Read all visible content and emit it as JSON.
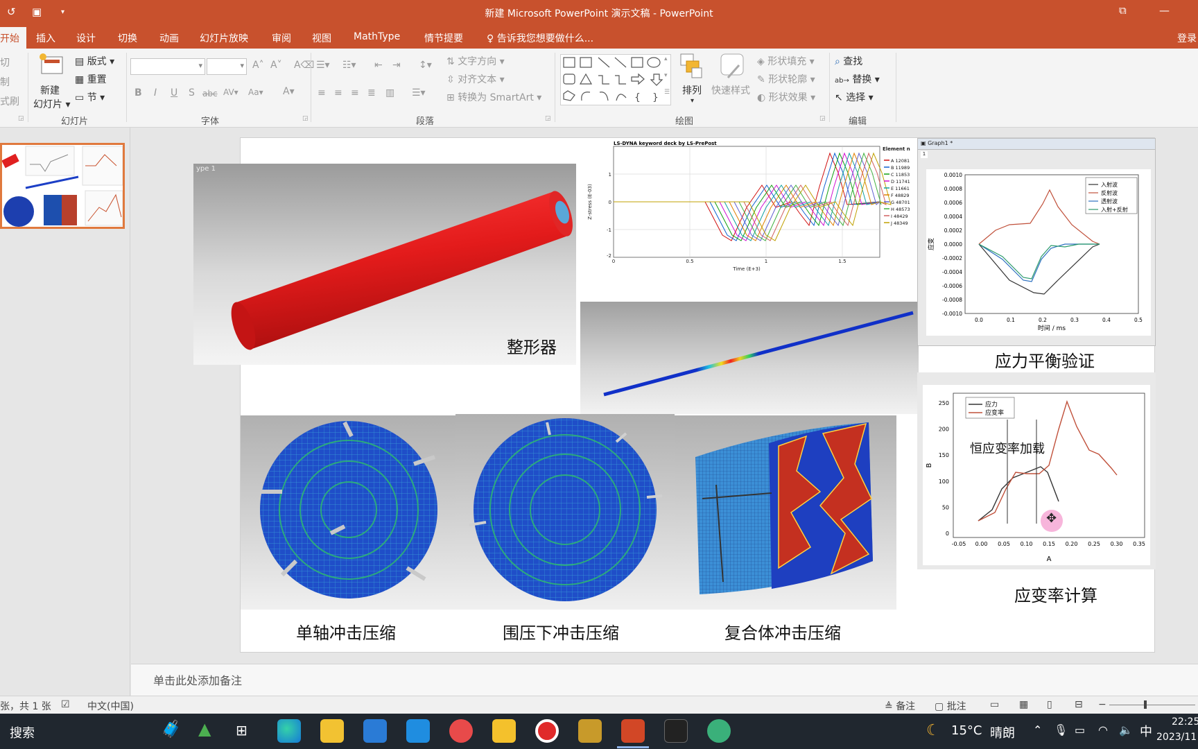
{
  "window": {
    "title": "新建 Microsoft PowerPoint 演示文稿 - PowerPoint"
  },
  "tabs": [
    {
      "label": "开始",
      "active": true
    },
    {
      "label": "插入"
    },
    {
      "label": "设计"
    },
    {
      "label": "切换"
    },
    {
      "label": "动画"
    },
    {
      "label": "幻灯片放映"
    },
    {
      "label": "审阅"
    },
    {
      "label": "视图"
    },
    {
      "label": "MathType"
    },
    {
      "label": "情节提要"
    }
  ],
  "tellme": "告诉我您想要做什么...",
  "login": "登录",
  "ribbon": {
    "clipboard": {
      "cut": "切",
      "copy": "制",
      "painter": "式刷"
    },
    "slides": {
      "new_slide_1": "新建",
      "new_slide_2": "幻灯片",
      "layout": "版式",
      "reset": "重置",
      "section": "节",
      "group": "幻灯片"
    },
    "font": {
      "group": "字体"
    },
    "paragraph": {
      "text_direction": "文字方向",
      "align_text": "对齐文本",
      "smartart": "转换为 SmartArt",
      "group": "段落"
    },
    "drawing": {
      "arrange": "排列",
      "quick_styles": "快速样式",
      "fill": "形状填充",
      "outline": "形状轮廓",
      "effects": "形状效果",
      "group": "绘图"
    },
    "editing": {
      "find": "查找",
      "replace": "替换",
      "select": "选择",
      "group": "编辑"
    }
  },
  "slide": {
    "captions": {
      "shaper": "整形器",
      "stress_balance": "应力平衡验证",
      "strain_rate": "应变率计算",
      "uniaxial": "单轴冲击压缩",
      "confined": "围压下冲击压缩",
      "composite": "复合体冲击压缩"
    },
    "constant_rate_label": "恒应变率加载",
    "lsdyna": {
      "header": "LS-DYNA keyword deck by LS-PrePost",
      "xlabel": "Time (E+3)",
      "ylabel": "Z-stress (E-03)",
      "legend_title": "Element no.",
      "legend": [
        "A 12081",
        "B 11989",
        "C 11853",
        "D 11741",
        "E 11661",
        "F 48829",
        "G 48701",
        "H 48573",
        "I 48429",
        "J 48349"
      ],
      "xticks": [
        "0",
        "0.5",
        "1",
        "1.5"
      ],
      "yticks": [
        "1",
        "0",
        "-1",
        "-2"
      ]
    },
    "graph1": {
      "window_title": "Graph1 *",
      "page_num": "1",
      "legend": [
        "入射波",
        "反射波",
        "透射波",
        "入射+反射"
      ],
      "xlabel": "时间 / ms",
      "ylabel": "应变",
      "xticks": [
        "0.0",
        "0.1",
        "0.2",
        "0.3",
        "0.4",
        "0.5"
      ],
      "yticks": [
        "0.0010",
        "0.0008",
        "0.0006",
        "0.0004",
        "0.0002",
        "0.0000",
        "-0.0002",
        "-0.0004",
        "-0.0006",
        "-0.0008",
        "-0.0010"
      ]
    },
    "graph2": {
      "legend": [
        "应力",
        "应变率"
      ],
      "xlabel": "A",
      "ylabel": "B",
      "xticks": [
        "-0.05",
        "0.00",
        "0.05",
        "0.10",
        "0.15",
        "0.20",
        "0.25",
        "0.30",
        "0.35"
      ],
      "yticks": [
        "250",
        "200",
        "150",
        "100",
        "50",
        "0"
      ]
    },
    "fem_label": "ype     1"
  },
  "notes_placeholder": "单击此处添加备注",
  "status": {
    "slide_count": "张，共 1 张",
    "language": "中文(中国)",
    "notes": "备注",
    "comments": "批注"
  },
  "taskbar": {
    "search": "搜索",
    "temperature": "15°C",
    "weather": "晴朗",
    "ime": "中",
    "time": "22:25",
    "date": "2023/11"
  },
  "colors": {
    "accent": "#c8512d",
    "thumb_border": "#e0793d",
    "taskbar": "#20272f"
  }
}
